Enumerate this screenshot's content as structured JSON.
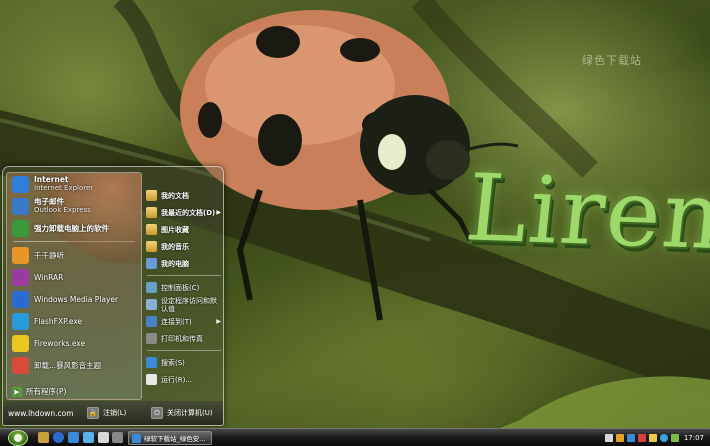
{
  "desktop": {
    "watermark": "绿色下载站",
    "brand_logo": "Lirenti"
  },
  "start_menu": {
    "pinned": [
      {
        "main": "Internet",
        "sub": "Internet Explorer",
        "icon": "internet-explorer-icon",
        "color": "#2f7fd8"
      },
      {
        "main": "电子邮件",
        "sub": "Outlook Express",
        "icon": "mail-icon",
        "color": "#3a78c8"
      },
      {
        "main": "强力卸载电脑上的软件",
        "sub": "",
        "icon": "uninstall-icon",
        "color": "#3a9a3a"
      }
    ],
    "recent": [
      {
        "main": "千千静听",
        "icon": "ttplayer-icon",
        "color": "#e8962a"
      },
      {
        "main": "WinRAR",
        "icon": "winrar-icon",
        "color": "#9a3aa0"
      },
      {
        "main": "Windows Media Player",
        "icon": "media-player-icon",
        "color": "#2a6ad0"
      },
      {
        "main": "FlashFXP.exe",
        "icon": "flashfxp-icon",
        "color": "#2a9ad8"
      },
      {
        "main": "Fireworks.exe",
        "icon": "fireworks-icon",
        "color": "#e8c820"
      },
      {
        "main": "卸载...暴风影音主题",
        "icon": "uninstall-theme-icon",
        "color": "#d84a3a"
      }
    ],
    "all_programs": "所有程序(P)",
    "right": [
      {
        "label": "我的文档",
        "bold": true,
        "icon": "my-documents-icon",
        "arrow": false
      },
      {
        "label": "我最近的文档(D)",
        "bold": true,
        "icon": "recent-documents-icon",
        "arrow": true
      },
      {
        "label": "图片收藏",
        "bold": true,
        "icon": "my-pictures-icon",
        "arrow": false
      },
      {
        "label": "我的音乐",
        "bold": true,
        "icon": "my-music-icon",
        "arrow": false
      },
      {
        "label": "我的电脑",
        "bold": true,
        "icon": "my-computer-icon",
        "arrow": false
      },
      {
        "label": "控制面板(C)",
        "bold": false,
        "icon": "control-panel-icon",
        "arrow": false
      },
      {
        "label": "设定程序访问和默认值",
        "bold": false,
        "icon": "program-defaults-icon",
        "arrow": false
      },
      {
        "label": "连接到(T)",
        "bold": false,
        "icon": "connect-to-icon",
        "arrow": true
      },
      {
        "label": "打印机和传真",
        "bold": false,
        "icon": "printer-icon",
        "arrow": false
      },
      {
        "label": "搜索(S)",
        "bold": false,
        "icon": "search-icon",
        "arrow": false
      },
      {
        "label": "运行(R)...",
        "bold": false,
        "icon": "run-icon",
        "arrow": false
      }
    ],
    "footer": {
      "site": "www.lhdown.com",
      "logoff": "注销(L)",
      "shutdown": "关闭计算机(U)"
    }
  },
  "taskbar": {
    "task_button": "绿软下载站_绿色安...",
    "clock": "17:07"
  }
}
